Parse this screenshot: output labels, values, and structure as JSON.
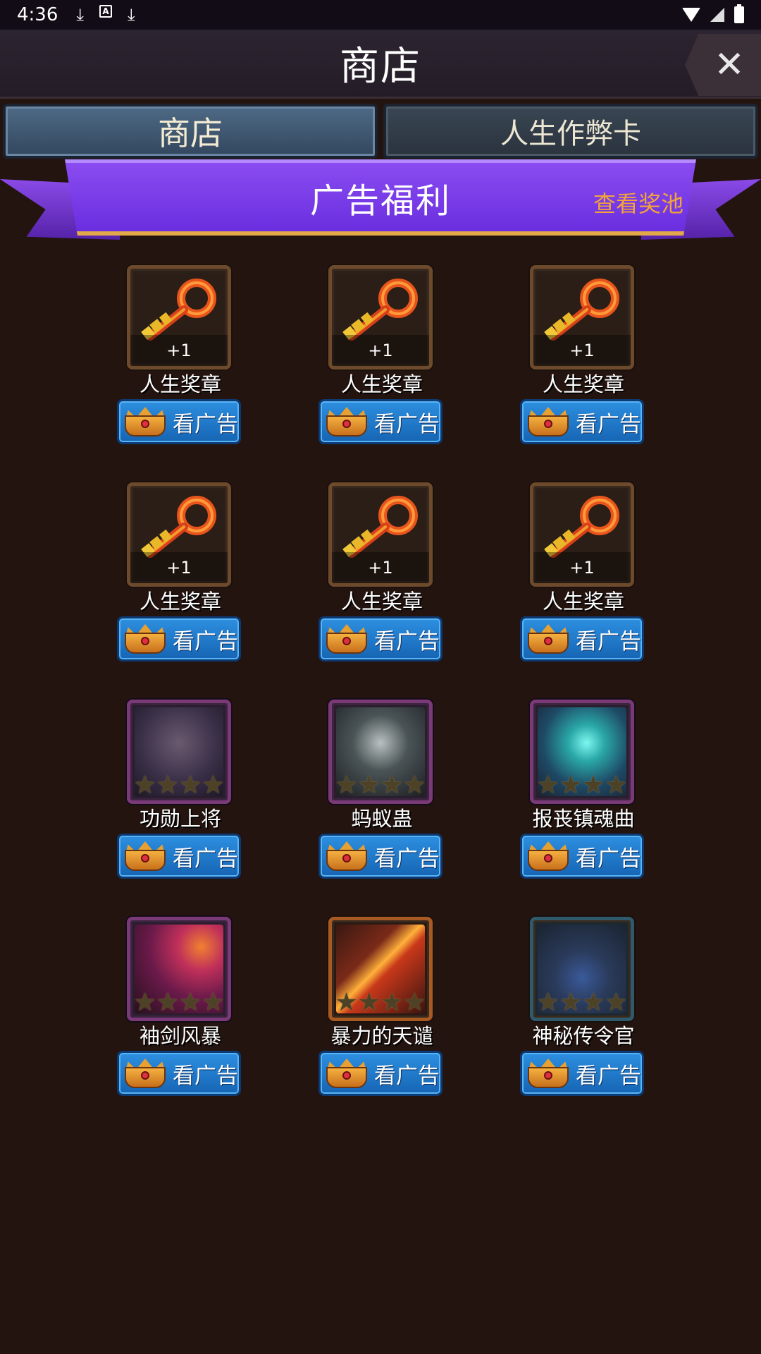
{
  "status_bar": {
    "time": "4:36"
  },
  "header": {
    "title": "商店",
    "close_symbol": "✕"
  },
  "tabs": [
    {
      "label": "商店",
      "active": true
    },
    {
      "label": "人生作弊卡",
      "active": false
    }
  ],
  "banner": {
    "title": "广告福利",
    "link": "查看奖池"
  },
  "items": [
    {
      "name": "人生奖章",
      "badge": "+1",
      "type": "key",
      "button": "看广告"
    },
    {
      "name": "人生奖章",
      "badge": "+1",
      "type": "key",
      "button": "看广告"
    },
    {
      "name": "人生奖章",
      "badge": "+1",
      "type": "key",
      "button": "看广告"
    },
    {
      "name": "人生奖章",
      "badge": "+1",
      "type": "key",
      "button": "看广告"
    },
    {
      "name": "人生奖章",
      "badge": "+1",
      "type": "key",
      "button": "看广告"
    },
    {
      "name": "人生奖章",
      "badge": "+1",
      "type": "key",
      "button": "看广告"
    },
    {
      "name": "功勋上将",
      "type": "card",
      "frame": "purple",
      "icon": "dwarf-warrior-portrait",
      "button": "看广告"
    },
    {
      "name": "蚂蚁蛊",
      "type": "card",
      "frame": "purple",
      "icon": "silver-mask-portrait",
      "button": "看广告"
    },
    {
      "name": "报丧镇魂曲",
      "type": "card",
      "frame": "purple",
      "icon": "teal-spirit-portrait",
      "button": "看广告"
    },
    {
      "name": "袖剑风暴",
      "type": "card",
      "frame": "purple",
      "icon": "crimson-storm-portrait",
      "button": "看广告"
    },
    {
      "name": "暴力的天谴",
      "type": "card",
      "frame": "orange",
      "icon": "fire-slash-portrait",
      "button": "看广告"
    },
    {
      "name": "神秘传令官",
      "type": "card",
      "frame": "teal",
      "icon": "hooded-herald-portrait",
      "button": "看广告"
    }
  ]
}
